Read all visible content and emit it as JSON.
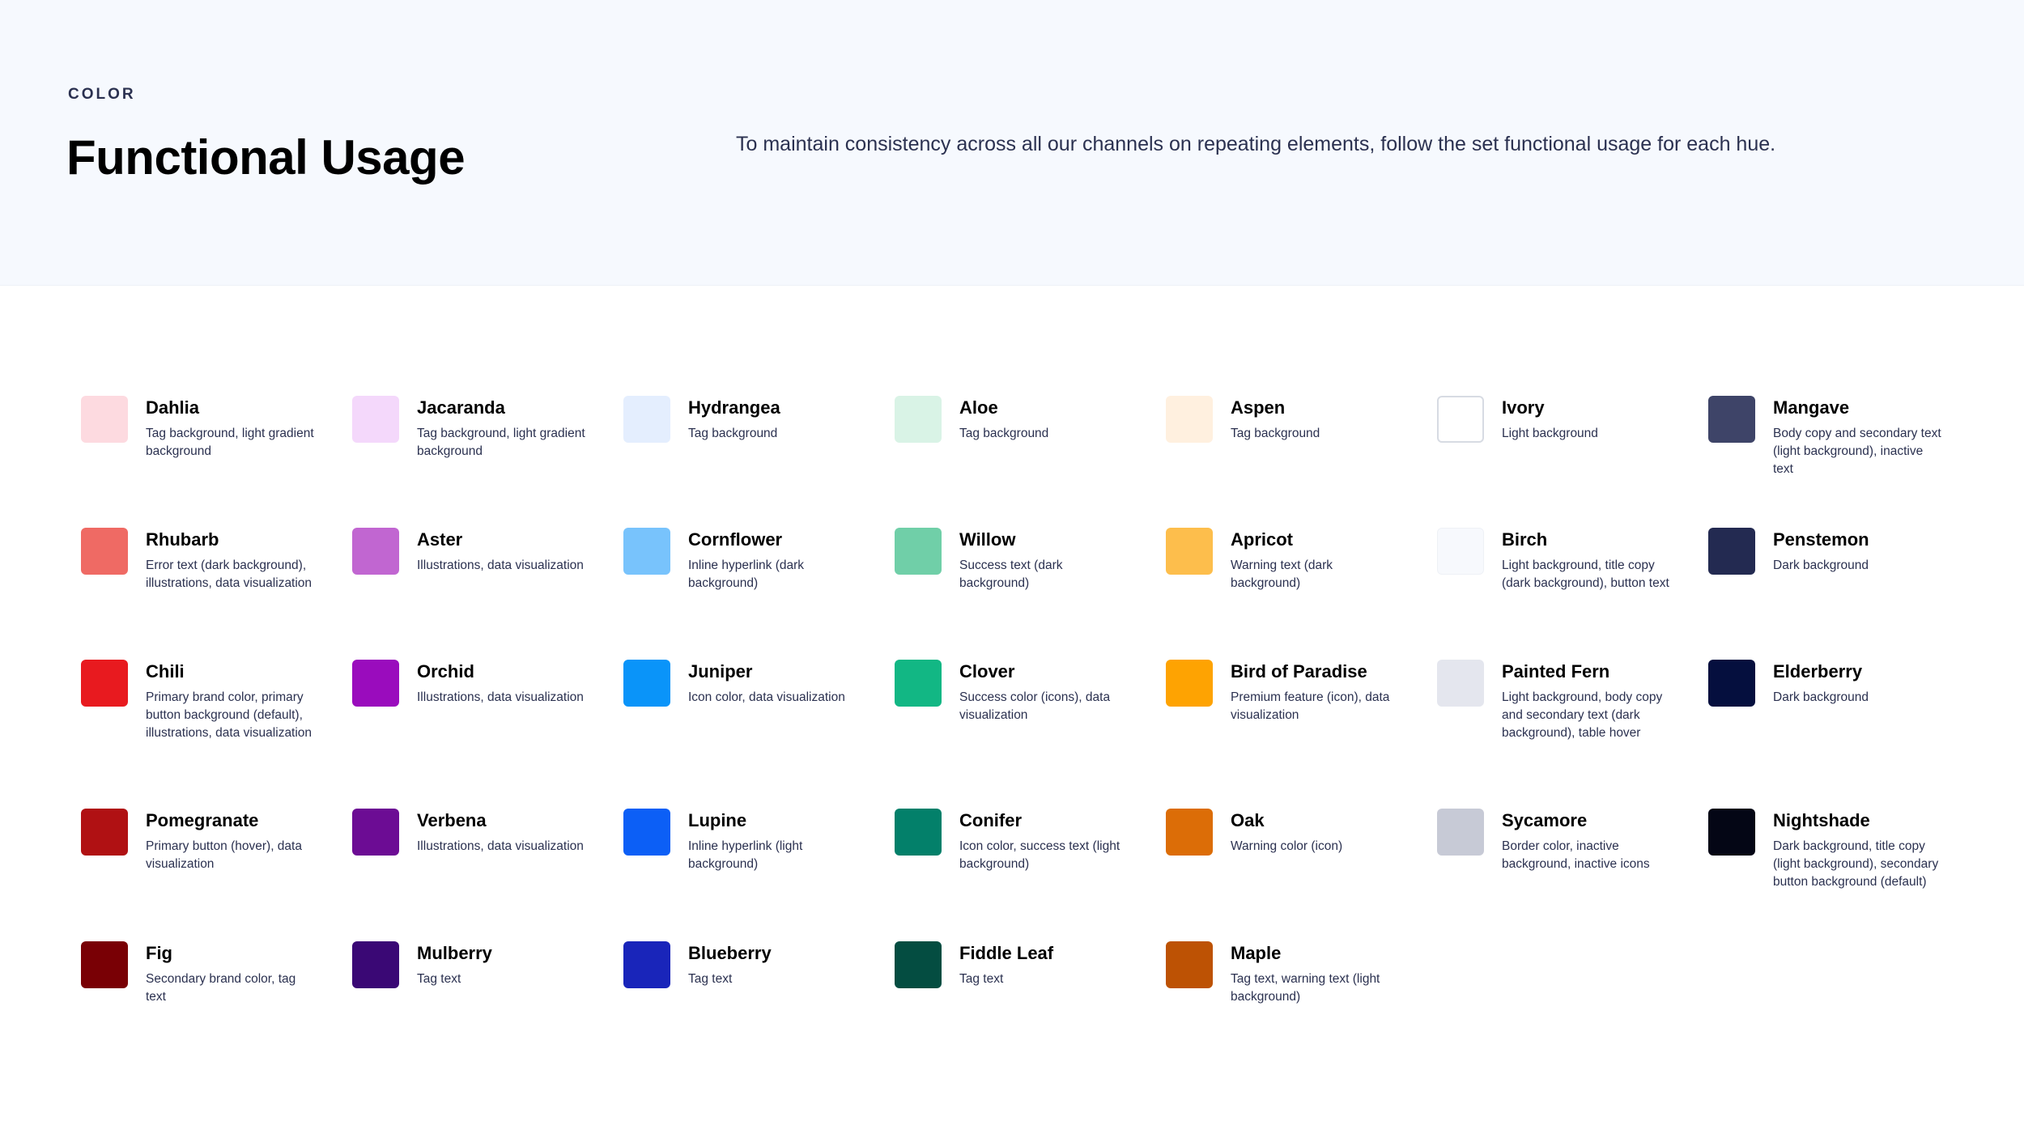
{
  "header": {
    "eyebrow": "COLOR",
    "title": "Functional Usage",
    "description": "To maintain consistency across all our channels on repeating elements, follow the set functional usage for each hue."
  },
  "colors": [
    {
      "name": "Dahlia",
      "usage": "Tag background, light gradient background",
      "hex": "#fddae0"
    },
    {
      "name": "Jacaranda",
      "usage": "Tag background, light gradient background",
      "hex": "#f4d8fb"
    },
    {
      "name": "Hydrangea",
      "usage": "Tag background",
      "hex": "#e4eefe"
    },
    {
      "name": "Aloe",
      "usage": "Tag background",
      "hex": "#d9f3e6"
    },
    {
      "name": "Aspen",
      "usage": "Tag background",
      "hex": "#fff0df"
    },
    {
      "name": "Ivory",
      "usage": "Light background",
      "hex": "#ffffff"
    },
    {
      "name": "Mangave",
      "usage": "Body copy and secondary text (light background), inactive text",
      "hex": "#3e4468"
    },
    {
      "name": "Rhubarb",
      "usage": "Error text (dark background), illustrations, data visualization",
      "hex": "#ef6a64"
    },
    {
      "name": "Aster",
      "usage": "Illustrations, data visualization",
      "hex": "#c166d1"
    },
    {
      "name": "Cornflower",
      "usage": "Inline hyperlink (dark background)",
      "hex": "#78c3fc"
    },
    {
      "name": "Willow",
      "usage": "Success text (dark background)",
      "hex": "#70cfa8"
    },
    {
      "name": "Apricot",
      "usage": "Warning text (dark background)",
      "hex": "#fdbe4c"
    },
    {
      "name": "Birch",
      "usage": "Light background, title copy (dark background), button text",
      "hex": "#f7f9fd"
    },
    {
      "name": "Penstemon",
      "usage": "Dark background",
      "hex": "#232a51"
    },
    {
      "name": "Chili",
      "usage": "Primary brand color, primary button background (default), illustrations, data visualization",
      "hex": "#e81a1f"
    },
    {
      "name": "Orchid",
      "usage": "Illustrations, data visualization",
      "hex": "#9a0cbd"
    },
    {
      "name": "Juniper",
      "usage": "Icon color, data visualization",
      "hex": "#0a94f9"
    },
    {
      "name": "Clover",
      "usage": "Success color (icons), data visualization",
      "hex": "#12b784"
    },
    {
      "name": "Bird of Paradise",
      "usage": "Premium feature (icon), data visualization",
      "hex": "#fea302"
    },
    {
      "name": "Painted Fern",
      "usage": "Light background, body copy and secondary text (dark background), table hover",
      "hex": "#e4e6ee"
    },
    {
      "name": "Elderberry",
      "usage": "Dark background",
      "hex": "#050f3e"
    },
    {
      "name": "Pomegranate",
      "usage": "Primary button (hover), data visualization",
      "hex": "#b01113"
    },
    {
      "name": "Verbena",
      "usage": "Illustrations, data visualization",
      "hex": "#6c0c94"
    },
    {
      "name": "Lupine",
      "usage": "Inline hyperlink (light background)",
      "hex": "#0c5ff6"
    },
    {
      "name": "Conifer",
      "usage": "Icon color, success text (light background)",
      "hex": "#03806a"
    },
    {
      "name": "Oak",
      "usage": "Warning color (icon)",
      "hex": "#dc6d07"
    },
    {
      "name": "Sycamore",
      "usage": "Border color, inactive background, inactive icons",
      "hex": "#c7cad6"
    },
    {
      "name": "Nightshade",
      "usage": "Dark background, title copy (light background), secondary button background (default)",
      "hex": "#040615"
    },
    {
      "name": "Fig",
      "usage": "Secondary brand color, tag text",
      "hex": "#790005"
    },
    {
      "name": "Mulberry",
      "usage": "Tag text",
      "hex": "#3a0875"
    },
    {
      "name": "Blueberry",
      "usage": "Tag text",
      "hex": "#1925ba"
    },
    {
      "name": "Fiddle Leaf",
      "usage": "Tag text",
      "hex": "#044d41"
    },
    {
      "name": "Maple",
      "usage": "Tag text, warning text (light background)",
      "hex": "#bd5204"
    }
  ]
}
